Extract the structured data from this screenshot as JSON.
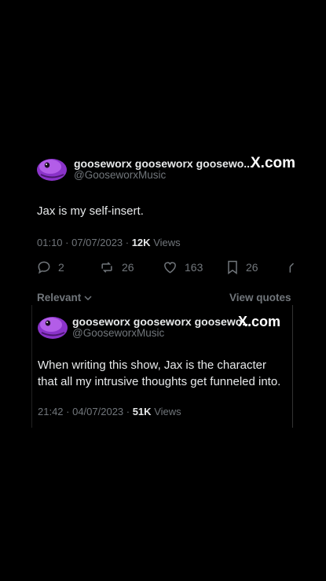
{
  "main_post": {
    "display_name": "gooseworx gooseworx goosewo...",
    "handle": "@GooseworxMusic",
    "site_logo": "X.com",
    "text": "Jax is my self-insert.",
    "timestamp": "01:10 · 07/07/2023 · ",
    "views_count": "12K",
    "views_label": "Views",
    "replies": "2",
    "reposts": "26",
    "likes": "163",
    "bookmarks": "26"
  },
  "relevant_label": "Relevant",
  "view_quotes_label": "View quotes",
  "quoted_post": {
    "display_name": "gooseworx gooseworx goosewo...",
    "handle": "@GooseworxMusic",
    "site_logo": "X.com",
    "text": "When writing this show, Jax is the character that all my intrusive thoughts get funneled into.",
    "timestamp": "21:42 · 04/07/2023 · ",
    "views_count": "51K",
    "views_label": "Views"
  },
  "colors": {
    "background": "#000000",
    "text_primary": "#e7e9ea",
    "text_secondary": "#71767b",
    "avatar_purple": "#9b3fd6"
  },
  "icons": [
    "reply-icon",
    "repost-icon",
    "like-icon",
    "bookmark-icon",
    "share-icon",
    "chevron-down-icon"
  ]
}
